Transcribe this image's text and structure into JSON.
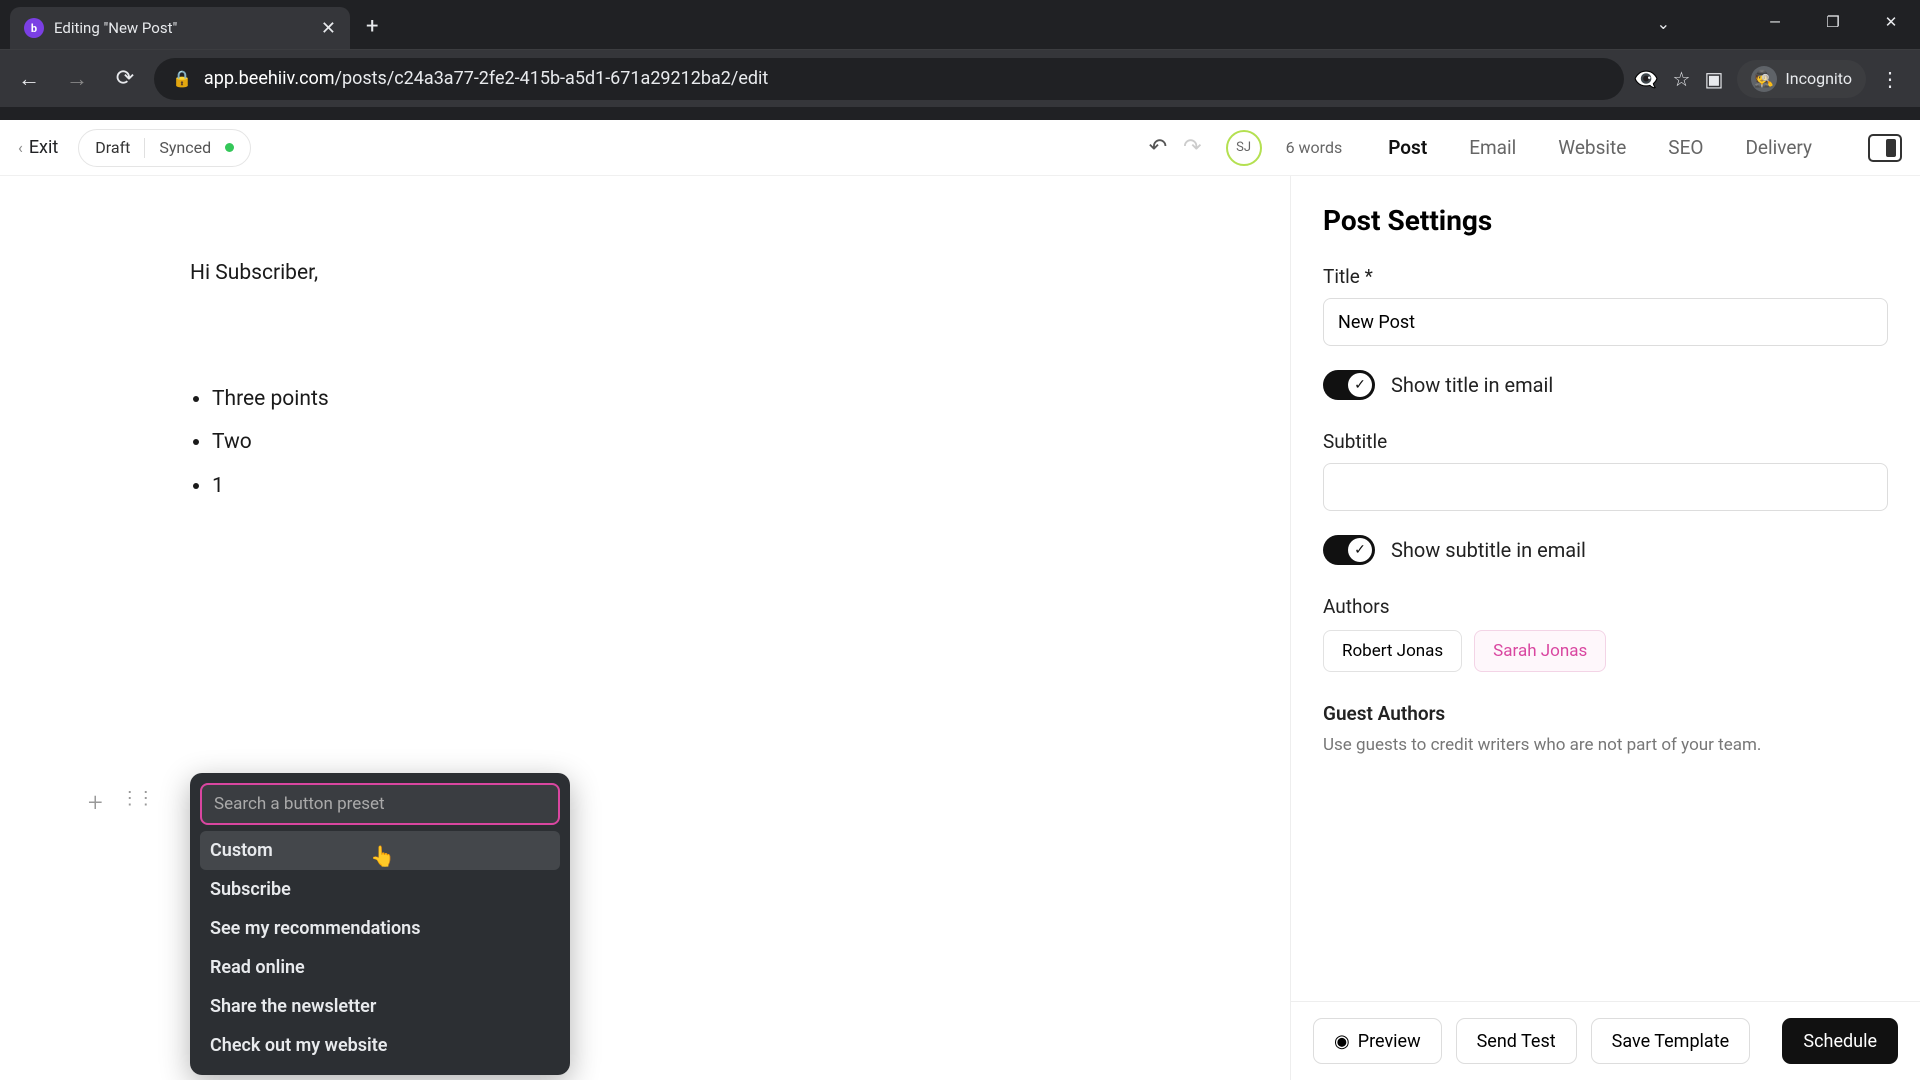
{
  "browser": {
    "tab_title": "Editing \"New Post\"",
    "url_domain": "app.beehiiv.com",
    "url_path": "/posts/c24a3a77-2fe2-415b-a5d1-671a29212ba2/edit",
    "incognito_label": "Incognito"
  },
  "topbar": {
    "exit": "Exit",
    "draft": "Draft",
    "synced": "Synced",
    "avatar_initials": "SJ",
    "word_count": "6 words",
    "tabs": [
      "Post",
      "Email",
      "Website",
      "SEO",
      "Delivery"
    ],
    "active_tab": "Post"
  },
  "editor": {
    "greeting": "Hi Subscriber,",
    "bullets": [
      "Three points",
      "Two",
      "1"
    ]
  },
  "popover": {
    "placeholder": "Search a button preset",
    "options": [
      "Custom",
      "Subscribe",
      "See my recommendations",
      "Read online",
      "Share the newsletter",
      "Check out my website"
    ],
    "highlighted": "Custom"
  },
  "settings": {
    "heading": "Post Settings",
    "title_label": "Title *",
    "title_value": "New Post",
    "show_title_label": "Show title in email",
    "subtitle_label": "Subtitle",
    "subtitle_value": "",
    "show_subtitle_label": "Show subtitle in email",
    "authors_label": "Authors",
    "authors": [
      "Robert Jonas",
      "Sarah Jonas"
    ],
    "guest_label": "Guest Authors",
    "guest_help": "Use guests to credit writers who are not part of your team."
  },
  "footer": {
    "preview": "Preview",
    "send_test": "Send Test",
    "save_template": "Save Template",
    "schedule": "Schedule"
  }
}
